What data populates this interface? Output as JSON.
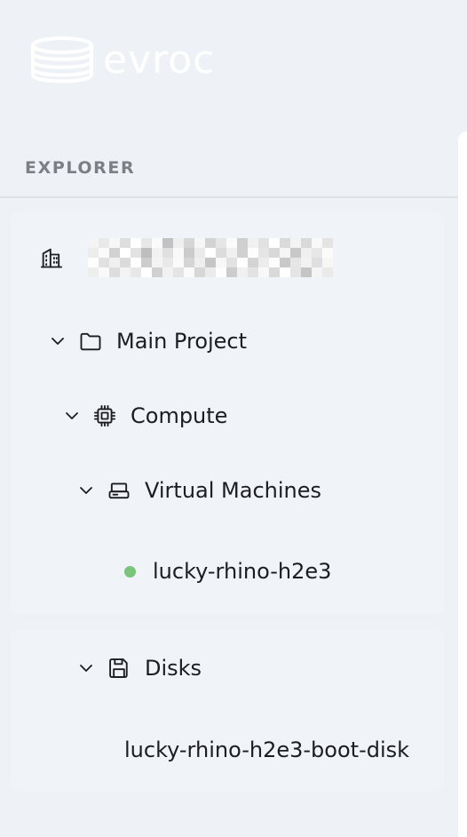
{
  "brand": {
    "name": "evroc",
    "logo_icon": "database-stack-icon"
  },
  "explorer": {
    "title": "EXPLORER"
  },
  "tree": {
    "organization": {
      "icon": "building-icon",
      "name_redacted": true
    },
    "project": {
      "label": "Main Project",
      "icon": "folder-icon",
      "expanded": true
    },
    "compute": {
      "label": "Compute",
      "icon": "cpu-chip-icon",
      "expanded": true
    },
    "virtual_machines": {
      "label": "Virtual Machines",
      "icon": "server-icon",
      "expanded": true
    },
    "vm_item": {
      "label": "lucky-rhino-h2e3",
      "status_color": "#7cc37c"
    },
    "disks": {
      "label": "Disks",
      "icon": "save-disk-icon",
      "expanded": true
    },
    "disk_item": {
      "label": "lucky-rhino-h2e3-boot-disk"
    }
  },
  "colors": {
    "sidebar_bg": "#eef2f6",
    "card_bg": "#f0f3f7",
    "text": "#1c1d21",
    "header_text": "#7b7f86"
  }
}
